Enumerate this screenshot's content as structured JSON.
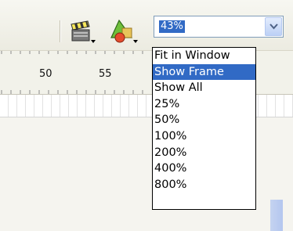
{
  "toolbar": {
    "buttons": [
      {
        "icon": "scene-clapperboard-icon",
        "has_dropdown": true
      },
      {
        "icon": "shapes-icon",
        "has_dropdown": true
      }
    ]
  },
  "zoom": {
    "current_value": "43%",
    "options": [
      {
        "label": "Fit in Window",
        "selected": false
      },
      {
        "label": "Show Frame",
        "selected": true
      },
      {
        "label": "Show All",
        "selected": false
      },
      {
        "label": "25%",
        "selected": false
      },
      {
        "label": "50%",
        "selected": false
      },
      {
        "label": "100%",
        "selected": false
      },
      {
        "label": "200%",
        "selected": false
      },
      {
        "label": "400%",
        "selected": false
      },
      {
        "label": "800%",
        "selected": false
      }
    ]
  },
  "ruler": {
    "labels": [
      "50",
      "55"
    ]
  },
  "colors": {
    "selection": "#316ac5",
    "toolbar_bg": "#ecebe1",
    "combo_border": "#7f9db9"
  }
}
